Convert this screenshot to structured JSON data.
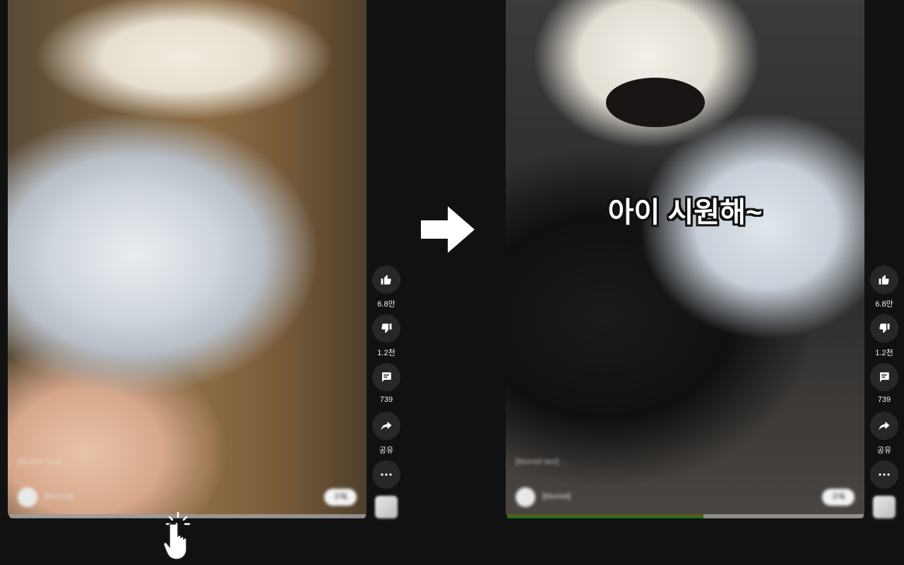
{
  "left_video": {
    "description_blurred": "[blurred text] ...",
    "channel_name_blurred": "[blurred]",
    "subscribe_label_blurred": "구독",
    "progress_fraction": 0.0
  },
  "right_video": {
    "overlay_caption": "아이 시원해~",
    "description_blurred": "[blurred text] ...",
    "channel_name_blurred": "[blurred]",
    "subscribe_label_blurred": "구독",
    "progress_fraction": 0.55
  },
  "actions": {
    "like_count": "6.8만",
    "dislike_count": "1.2천",
    "comment_count": "739",
    "share_label": "공유"
  },
  "icons": {
    "like": "thumb-up-icon",
    "dislike": "thumb-down-icon",
    "comment": "comment-icon",
    "share": "share-arrow-icon",
    "more": "more-dots-icon",
    "transition": "right-arrow-icon",
    "cursor": "pointer-hand-icon"
  },
  "colors": {
    "background": "#111111",
    "button_bg": "#272727",
    "progress_played": "#1f7a18",
    "progress_head": "#e02020"
  }
}
